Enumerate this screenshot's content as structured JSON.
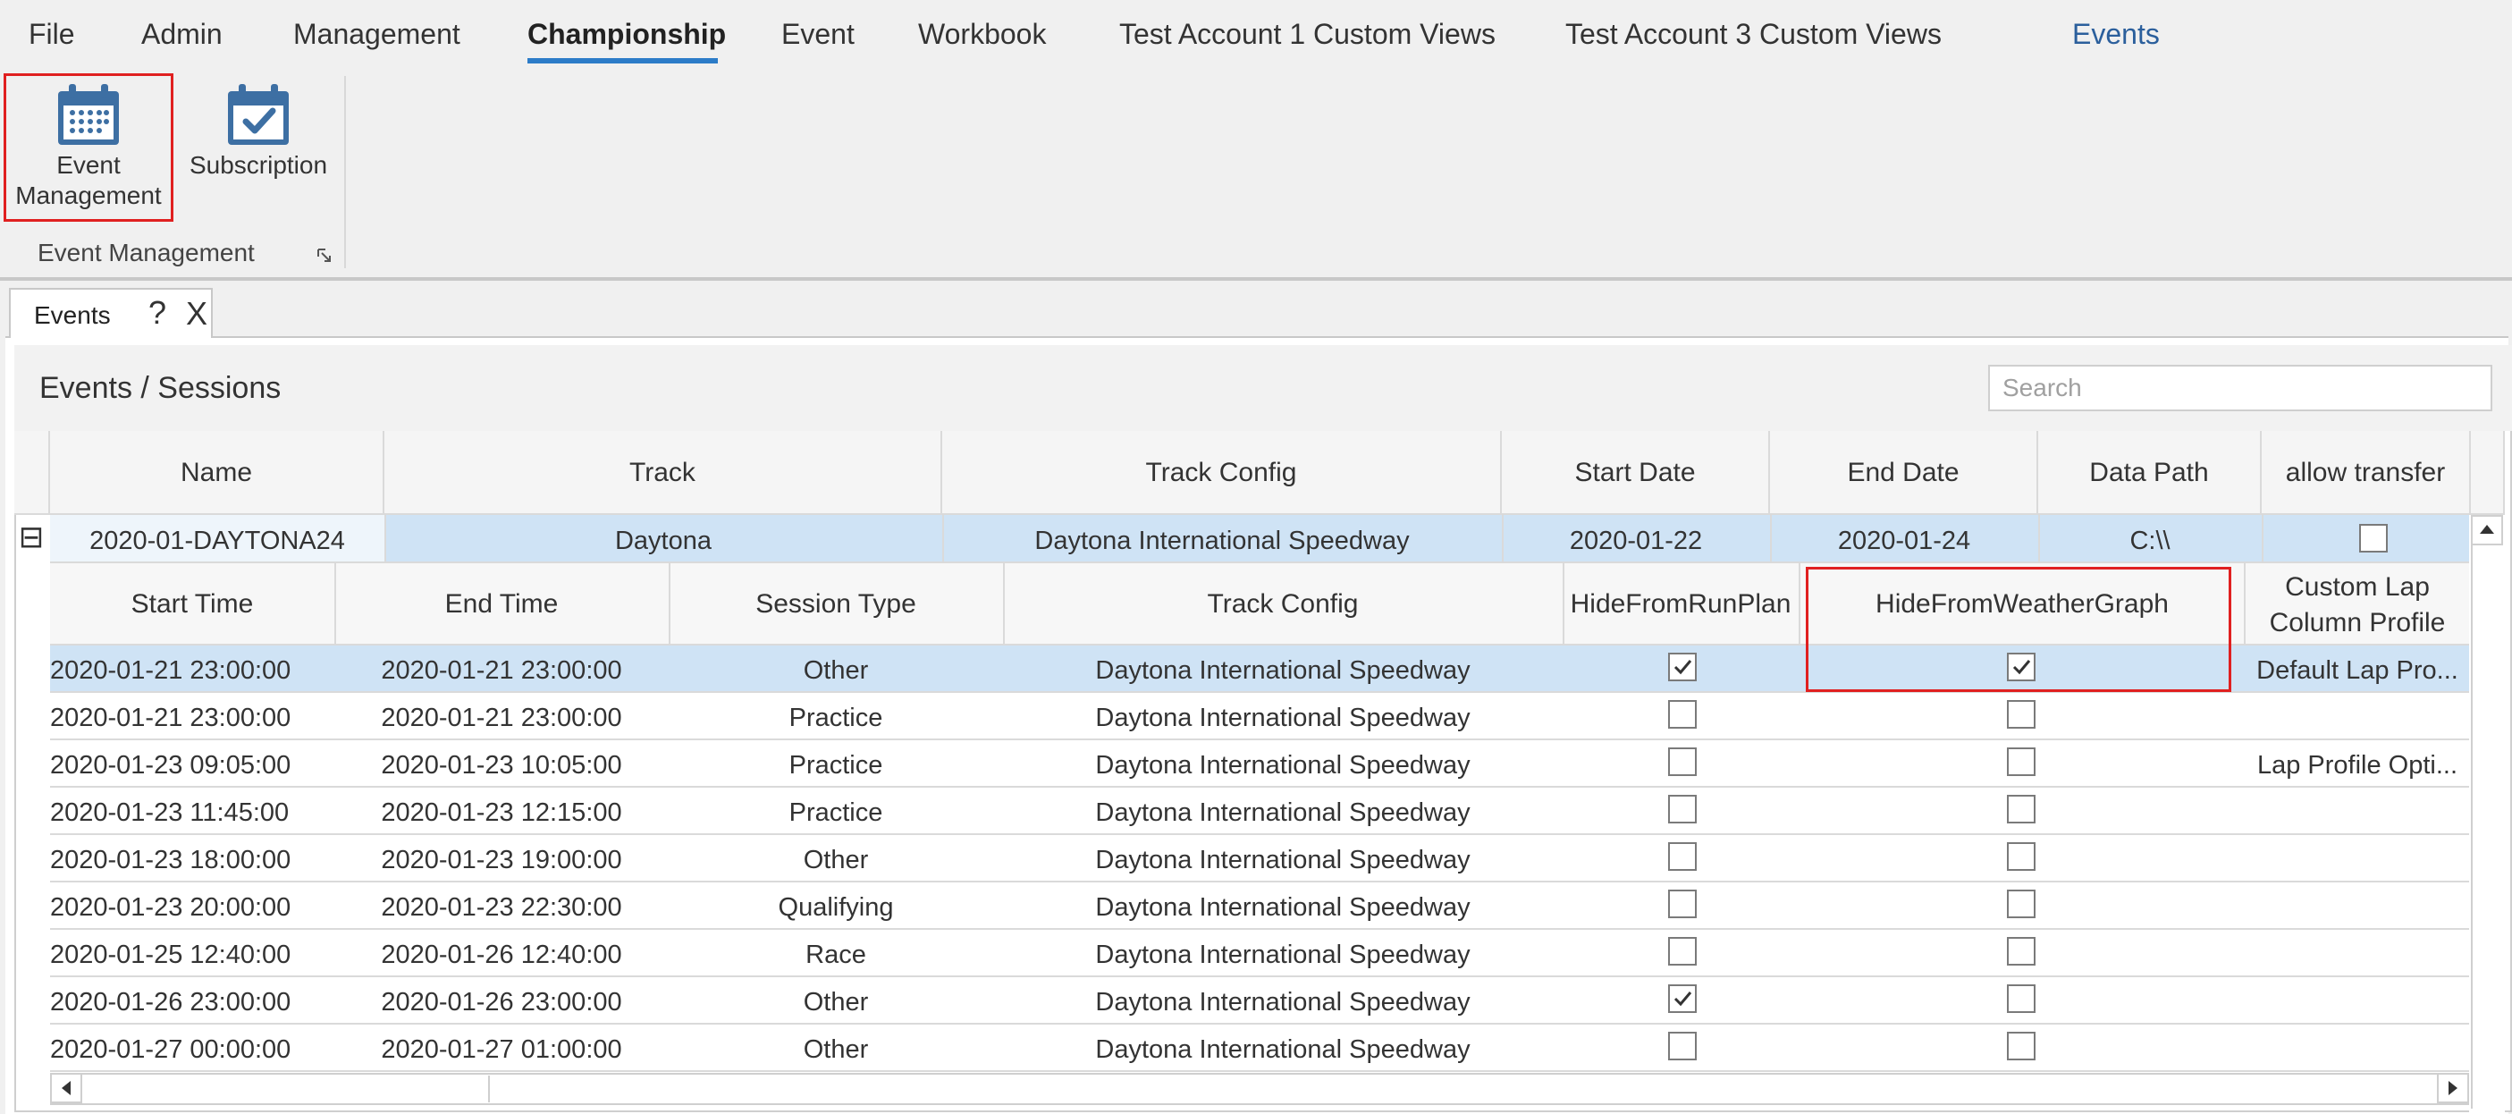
{
  "menu": {
    "items": [
      "File",
      "Admin",
      "Management",
      "Championship",
      "Event",
      "Workbook",
      "Test Account 1 Custom Views",
      "Test Account 3 Custom Views"
    ],
    "active": "Championship",
    "right_link": "Events"
  },
  "ribbon": {
    "event_management_line1": "Event",
    "event_management_line2": "Management",
    "subscription_label": "Subscription",
    "group_label": "Event Management"
  },
  "tab": {
    "label": "Events",
    "help": "?",
    "close": "X"
  },
  "panel": {
    "title": "Events / Sessions",
    "search_placeholder": "Search"
  },
  "events_table": {
    "columns": [
      "Name",
      "Track",
      "Track Config",
      "Start Date",
      "End Date",
      "Data Path",
      "allow transfer"
    ],
    "expander": "⊟",
    "rows": [
      {
        "name": "2020-01-DAYTONA24",
        "track": "Daytona",
        "track_config": "Daytona International Speedway",
        "start_date": "2020-01-22",
        "end_date": "2020-01-24",
        "data_path": "C:\\\\",
        "allow_transfer": false
      }
    ]
  },
  "sessions_table": {
    "columns": [
      "Start Time",
      "End Time",
      "Session Type",
      "Track Config",
      "HideFromRunPlan",
      "HideFromWeatherGraph",
      "Custom Lap",
      "Column Profile"
    ],
    "rows": [
      {
        "start": "2020-01-21 23:00:00",
        "end": "2020-01-21 23:00:00",
        "type": "Other",
        "config": "Daytona International Speedway",
        "hide_run": true,
        "hide_weather": true,
        "profile": "Default Lap Pro..."
      },
      {
        "start": "2020-01-21 23:00:00",
        "end": "2020-01-21 23:00:00",
        "type": "Practice",
        "config": "Daytona International Speedway",
        "hide_run": false,
        "hide_weather": false,
        "profile": ""
      },
      {
        "start": "2020-01-23 09:05:00",
        "end": "2020-01-23 10:05:00",
        "type": "Practice",
        "config": "Daytona International Speedway",
        "hide_run": false,
        "hide_weather": false,
        "profile": "Lap Profile Opti..."
      },
      {
        "start": "2020-01-23 11:45:00",
        "end": "2020-01-23 12:15:00",
        "type": "Practice",
        "config": "Daytona International Speedway",
        "hide_run": false,
        "hide_weather": false,
        "profile": ""
      },
      {
        "start": "2020-01-23 18:00:00",
        "end": "2020-01-23 19:00:00",
        "type": "Other",
        "config": "Daytona International Speedway",
        "hide_run": false,
        "hide_weather": false,
        "profile": ""
      },
      {
        "start": "2020-01-23 20:00:00",
        "end": "2020-01-23 22:30:00",
        "type": "Qualifying",
        "config": "Daytona International Speedway",
        "hide_run": false,
        "hide_weather": false,
        "profile": ""
      },
      {
        "start": "2020-01-25 12:40:00",
        "end": "2020-01-26 12:40:00",
        "type": "Race",
        "config": "Daytona International Speedway",
        "hide_run": false,
        "hide_weather": false,
        "profile": ""
      },
      {
        "start": "2020-01-26 23:00:00",
        "end": "2020-01-26 23:00:00",
        "type": "Other",
        "config": "Daytona International Speedway",
        "hide_run": true,
        "hide_weather": false,
        "profile": ""
      },
      {
        "start": "2020-01-27 00:00:00",
        "end": "2020-01-27 01:00:00",
        "type": "Other",
        "config": "Daytona International Speedway",
        "hide_run": false,
        "hide_weather": false,
        "profile": ""
      }
    ]
  },
  "colors": {
    "accent": "#2c7cc8",
    "selected_row": "#cfe3f5",
    "highlight_border": "#e02020",
    "link": "#2b5f9c"
  }
}
